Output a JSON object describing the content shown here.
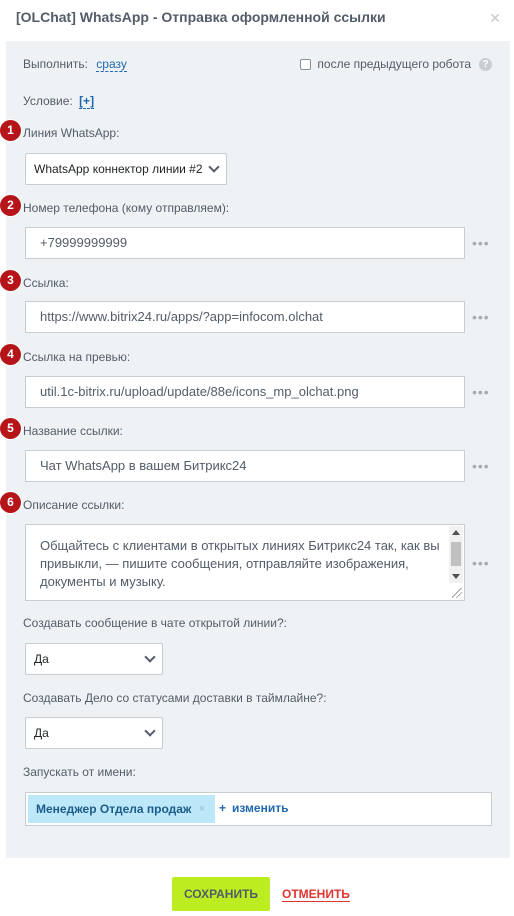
{
  "window": {
    "title": "[OLChat] WhatsApp - Отправка оформленной ссылки",
    "close_icon": "close-icon"
  },
  "header": {
    "execute_label": "Выполнить:",
    "execute_value": "сразу",
    "after_robot_label": "после предыдущего робота",
    "help_glyph": "?",
    "condition_label": "Условие:",
    "condition_link": "[+]"
  },
  "fields": {
    "line": {
      "badge": "1",
      "label": "Линия WhatsApp:",
      "value": "WhatsApp коннектор линии #2"
    },
    "phone": {
      "badge": "2",
      "label": "Номер телефона (кому отправляем):",
      "value": "+79999999999"
    },
    "link": {
      "badge": "3",
      "label": "Ссылка:",
      "value": "https://www.bitrix24.ru/apps/?app=infocom.olchat"
    },
    "preview": {
      "badge": "4",
      "label": "Ссылка на превью:",
      "value": "util.1c-bitrix.ru/upload/update/88e/icons_mp_olchat.png"
    },
    "link_name": {
      "badge": "5",
      "label": "Название ссылки:",
      "value": "Чат WhatsApp в вашем Битрикс24"
    },
    "description": {
      "badge": "6",
      "label": "Описание ссылки:",
      "value": "Общайтесь с клиентами в открытых линиях Битрикс24 так, как вы привыкли, — пишите сообщения, отправляйте изображения, документы и музыку."
    },
    "more_glyph": "•••"
  },
  "options": {
    "create_message": {
      "label": "Создавать сообщение в чате открытой линии?:",
      "value": "Да"
    },
    "create_activity": {
      "label": "Создавать Дело со статусами доставки в таймлайне?:",
      "value": "Да"
    },
    "run_as": {
      "label": "Запускать от имени:",
      "user": "Менеджер Отдела продаж",
      "remove_glyph": "×",
      "change_plus": "+",
      "change_label": "изменить"
    }
  },
  "footer": {
    "save": "СОХРАНИТЬ",
    "cancel": "ОТМЕНИТЬ"
  },
  "colors": {
    "badge": "#b51418",
    "link": "#2067b0",
    "save_bg": "#bbed21",
    "cancel": "#e0342f",
    "panel_bg": "#eef2f4",
    "tag_bg": "#bce8f9"
  }
}
